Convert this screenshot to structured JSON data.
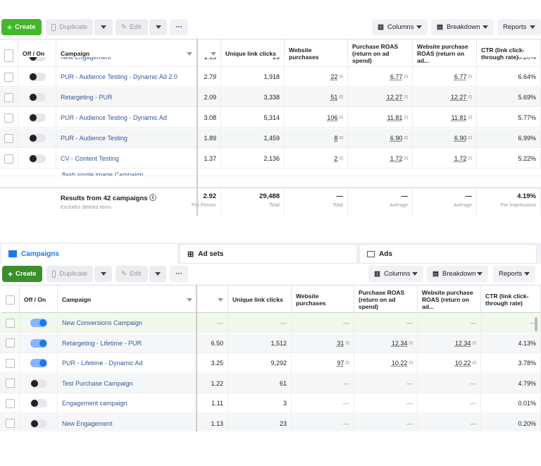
{
  "toolbar": {
    "create": "Create",
    "duplicate": "Duplicate",
    "edit": "Edit",
    "more": "···",
    "columns": "Columns",
    "breakdown": "Breakdown",
    "reports": "Reports"
  },
  "columns": {
    "offon": "Off / On",
    "campaign": "Campaign",
    "unique_link_clicks": "Unique link clicks",
    "website_purchases": "Website purchases",
    "purchase_roas": "Purchase ROAS (return on ad spend)",
    "website_purchase_roas": "Website purchase ROAS (return on ad...",
    "ctr": "CTR (link click-through rate)"
  },
  "top": {
    "partial_top": {
      "name": "New Engagement",
      "c1": "1.13",
      "c2": "23",
      "c3": "",
      "c4": "",
      "c5": "",
      "c6": "0.20%"
    },
    "rows": [
      {
        "name": "PUR - Audience Testing - Dynamic Ad 2.0",
        "c1": "2.79",
        "c2": "1,918",
        "c3": "22",
        "c4": "6.77",
        "c5": "6.77",
        "c6": "6.64%"
      },
      {
        "name": "Retargeting - PUR",
        "c1": "2.09",
        "c2": "3,338",
        "c3": "51",
        "c4": "12.27",
        "c5": "12.27",
        "c6": "5.69%"
      },
      {
        "name": "PUR - Audience Testing - Dynamic Ad",
        "c1": "3.08",
        "c2": "5,314",
        "c3": "106",
        "c4": "11.81",
        "c5": "11.81",
        "c6": "5.77%"
      },
      {
        "name": "PUR - Audience Testing",
        "c1": "1.89",
        "c2": "1,459",
        "c3": "8",
        "c4": "6.90",
        "c5": "6.90",
        "c6": "6.99%"
      },
      {
        "name": "CV - Content Testing",
        "c1": "1.37",
        "c2": "2,136",
        "c3": "2",
        "c4": "1.72",
        "c5": "1.72",
        "c6": "5.22%"
      }
    ],
    "partial_bottom": "flash single image Campaign",
    "totals": {
      "label": "Results from 42 campaigns",
      "sub": "Excludes deleted items",
      "c1": "2.92",
      "c1s": "Per Person",
      "c2": "29,488",
      "c2s": "Total",
      "c3": "—",
      "c3s": "Total",
      "c4": "—",
      "c4s": "Average",
      "c5": "—",
      "c5s": "Average",
      "c6": "4.19%",
      "c6s": "Per Impressions"
    }
  },
  "tabs": {
    "campaigns": "Campaigns",
    "adsets": "Ad sets",
    "ads": "Ads"
  },
  "bottom": {
    "rows": [
      {
        "name": "New Conversions Campaign",
        "on": true,
        "c1": "—",
        "c2": "—",
        "c3": "—",
        "c4": "—",
        "c5": "—",
        "c6": "—"
      },
      {
        "name": "Retargeting - Lifetime - PUR",
        "on": true,
        "c1": "6.50",
        "c2": "1,512",
        "c3": "31",
        "c4": "12.34",
        "c5": "12.34",
        "c6": "4.13%"
      },
      {
        "name": "PUR - Lifetime - Dynamic Ad",
        "on": true,
        "c1": "3.25",
        "c2": "9,292",
        "c3": "97",
        "c4": "10.22",
        "c5": "10.22",
        "c6": "3.78%"
      },
      {
        "name": "Test Purchase Campaign",
        "on": false,
        "c1": "1.22",
        "c2": "61",
        "c3": "—",
        "c4": "—",
        "c5": "—",
        "c6": "4.79%"
      },
      {
        "name": "Engagement campaign",
        "on": false,
        "c1": "1.11",
        "c2": "3",
        "c3": "—",
        "c4": "—",
        "c5": "—",
        "c6": "0.01%"
      },
      {
        "name": "New Engagement",
        "on": false,
        "c1": "1.13",
        "c2": "23",
        "c3": "—",
        "c4": "—",
        "c5": "—",
        "c6": "0.20%"
      }
    ]
  },
  "colors": {
    "accent": "#1877f2",
    "create": "#42b72a",
    "link": "#385898"
  }
}
